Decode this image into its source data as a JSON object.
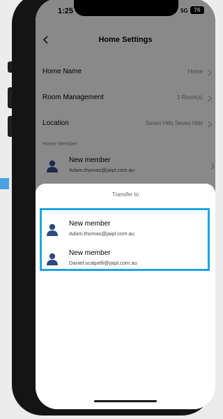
{
  "status_bar": {
    "time": "1:25",
    "network": "5G",
    "battery": "76"
  },
  "nav": {
    "title": "Home Settings"
  },
  "settings": [
    {
      "label": "Home Name",
      "value": "Home"
    },
    {
      "label": "Room Management",
      "value": "3 Room(s)"
    },
    {
      "label": "Location",
      "value": "Seven Hills Seven Hills"
    }
  ],
  "home_member": {
    "section_label": "Home Member",
    "member": {
      "name": "New member",
      "email": "Adam.thomas@jaipl.com.au"
    }
  },
  "sheet": {
    "title": "Transfer to",
    "members": [
      {
        "name": "New member",
        "email": "Adam.thomas@jaipl.com.au"
      },
      {
        "name": "New member",
        "email": "Daniel.scalpelli@jaipl.com.au"
      }
    ]
  },
  "colors": {
    "accent": "#1ea5e3",
    "avatar": "#2f4a83"
  }
}
